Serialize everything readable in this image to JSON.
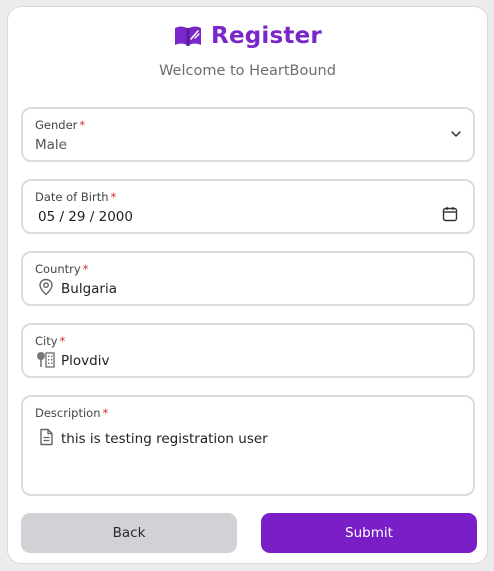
{
  "header": {
    "title": "Register",
    "subtitle": "Welcome to HeartBound",
    "logo_icon": "open-book-icon",
    "accent_color": "#7a26c9"
  },
  "form": {
    "required_marker": "*",
    "gender": {
      "label": "Gender",
      "value": "Male",
      "icon": "chevron-down-icon"
    },
    "dob": {
      "label": "Date of Birth",
      "value": "05 / 29 / 2000",
      "icon": "calendar-icon"
    },
    "country": {
      "label": "Country",
      "value": "Bulgaria",
      "icon": "location-pin-icon"
    },
    "city": {
      "label": "City",
      "value": "Plovdiv",
      "icon": "city-icon"
    },
    "description": {
      "label": "Description",
      "value": "this is testing registration user",
      "icon": "document-icon"
    }
  },
  "buttons": {
    "back": "Back",
    "submit": "Submit",
    "submit_color": "#7a1fc7"
  }
}
